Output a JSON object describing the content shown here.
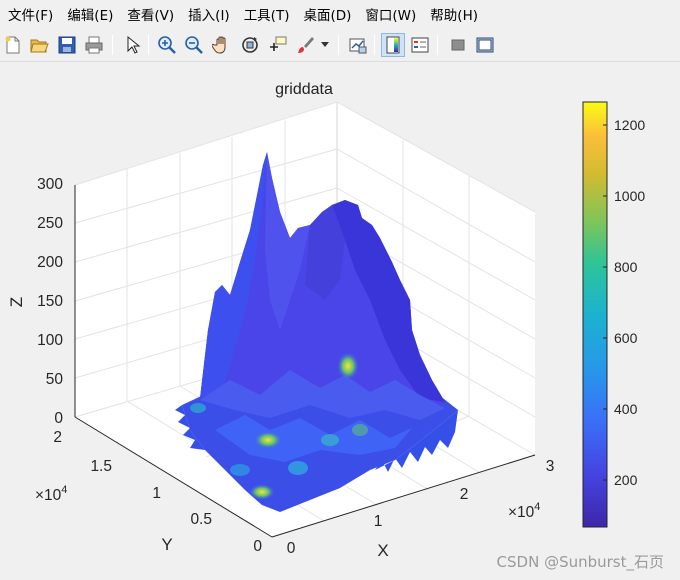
{
  "menu": [
    "文件(F)",
    "编辑(E)",
    "查看(V)",
    "插入(I)",
    "工具(T)",
    "桌面(D)",
    "窗口(W)",
    "帮助(H)"
  ],
  "toolbar": {
    "buttons": [
      "new-figure-icon",
      "open-file-icon",
      "save-icon",
      "print-icon",
      "pointer-icon",
      "zoom-in-icon",
      "zoom-out-icon",
      "pan-hand-icon",
      "rotate-3d-icon",
      "data-cursor-icon",
      "brush-icon",
      "dropdown-arrow-icon",
      "link-plot-icon",
      "insert-colorbar-icon",
      "insert-legend-icon",
      "hide-plot-tools-icon",
      "show-plot-tools-icon"
    ]
  },
  "chart_data": {
    "type": "surface",
    "title": "griddata",
    "xlabel": "X",
    "ylabel": "Y",
    "zlabel": "Z",
    "x_ticks": [
      "0",
      "1",
      "2",
      "3"
    ],
    "x_exponent": "×10",
    "x_exponent_power": "4",
    "y_ticks": [
      "0",
      "0.5",
      "1",
      "1.5",
      "2"
    ],
    "y_exponent": "×10",
    "y_exponent_power": "4",
    "z_ticks": [
      "0",
      "50",
      "100",
      "150",
      "200",
      "250",
      "300"
    ],
    "xlim": [
      0,
      30000
    ],
    "ylim": [
      0,
      20000
    ],
    "zlim": [
      0,
      300
    ],
    "colorbar": {
      "ticks": [
        "200",
        "400",
        "600",
        "800",
        "1000",
        "1200"
      ],
      "range": [
        60,
        1260
      ],
      "colormap": "parula"
    },
    "grid": true
  },
  "colors": {
    "surface_main": "#3f45e6",
    "colormap_stops": [
      "#3e26a8",
      "#4143e1",
      "#3b6ff7",
      "#2797eb",
      "#1fb2cf",
      "#2cc29a",
      "#81c55a",
      "#d2bb30",
      "#fdc038",
      "#f9fb15"
    ]
  },
  "watermark": "CSDN @Sunburst_石页"
}
